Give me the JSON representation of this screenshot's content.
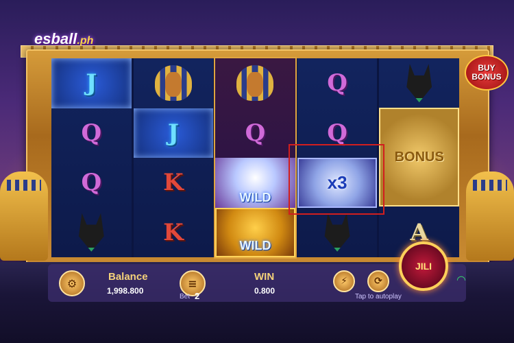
{
  "brand": {
    "logo_main": "esball",
    "logo_suffix": ".ph"
  },
  "buy_bonus": {
    "line1": "BUY",
    "line2": "BONUS"
  },
  "reels": [
    [
      "J",
      "Q",
      "Q",
      "anubis"
    ],
    [
      "pharaoh",
      "J",
      "K",
      "K"
    ],
    [
      "pharaoh",
      "Q",
      "WILD",
      "WILD"
    ],
    [
      "Q",
      "Q",
      "x3",
      "anubis"
    ],
    [
      "anubis",
      "BONUS",
      "A",
      "A"
    ]
  ],
  "symbols": {
    "wild_label": "WILD",
    "multiplier_label": "x3",
    "bonus_label": "BONUS"
  },
  "bottom_bar": {
    "balance_label": "Balance",
    "balance_value": "1,998.800",
    "bet_label": "Bet",
    "bet_value": "2",
    "win_label": "WIN",
    "win_value": "0.800",
    "autoplay_hint": "Tap to autoplay",
    "spin_label": "JILI"
  },
  "icons": {
    "settings": "gear-icon",
    "bet": "coin-stack-icon",
    "turbo": "lightning-icon",
    "autoplay": "autoplay-icon",
    "signal": "wifi-icon"
  }
}
